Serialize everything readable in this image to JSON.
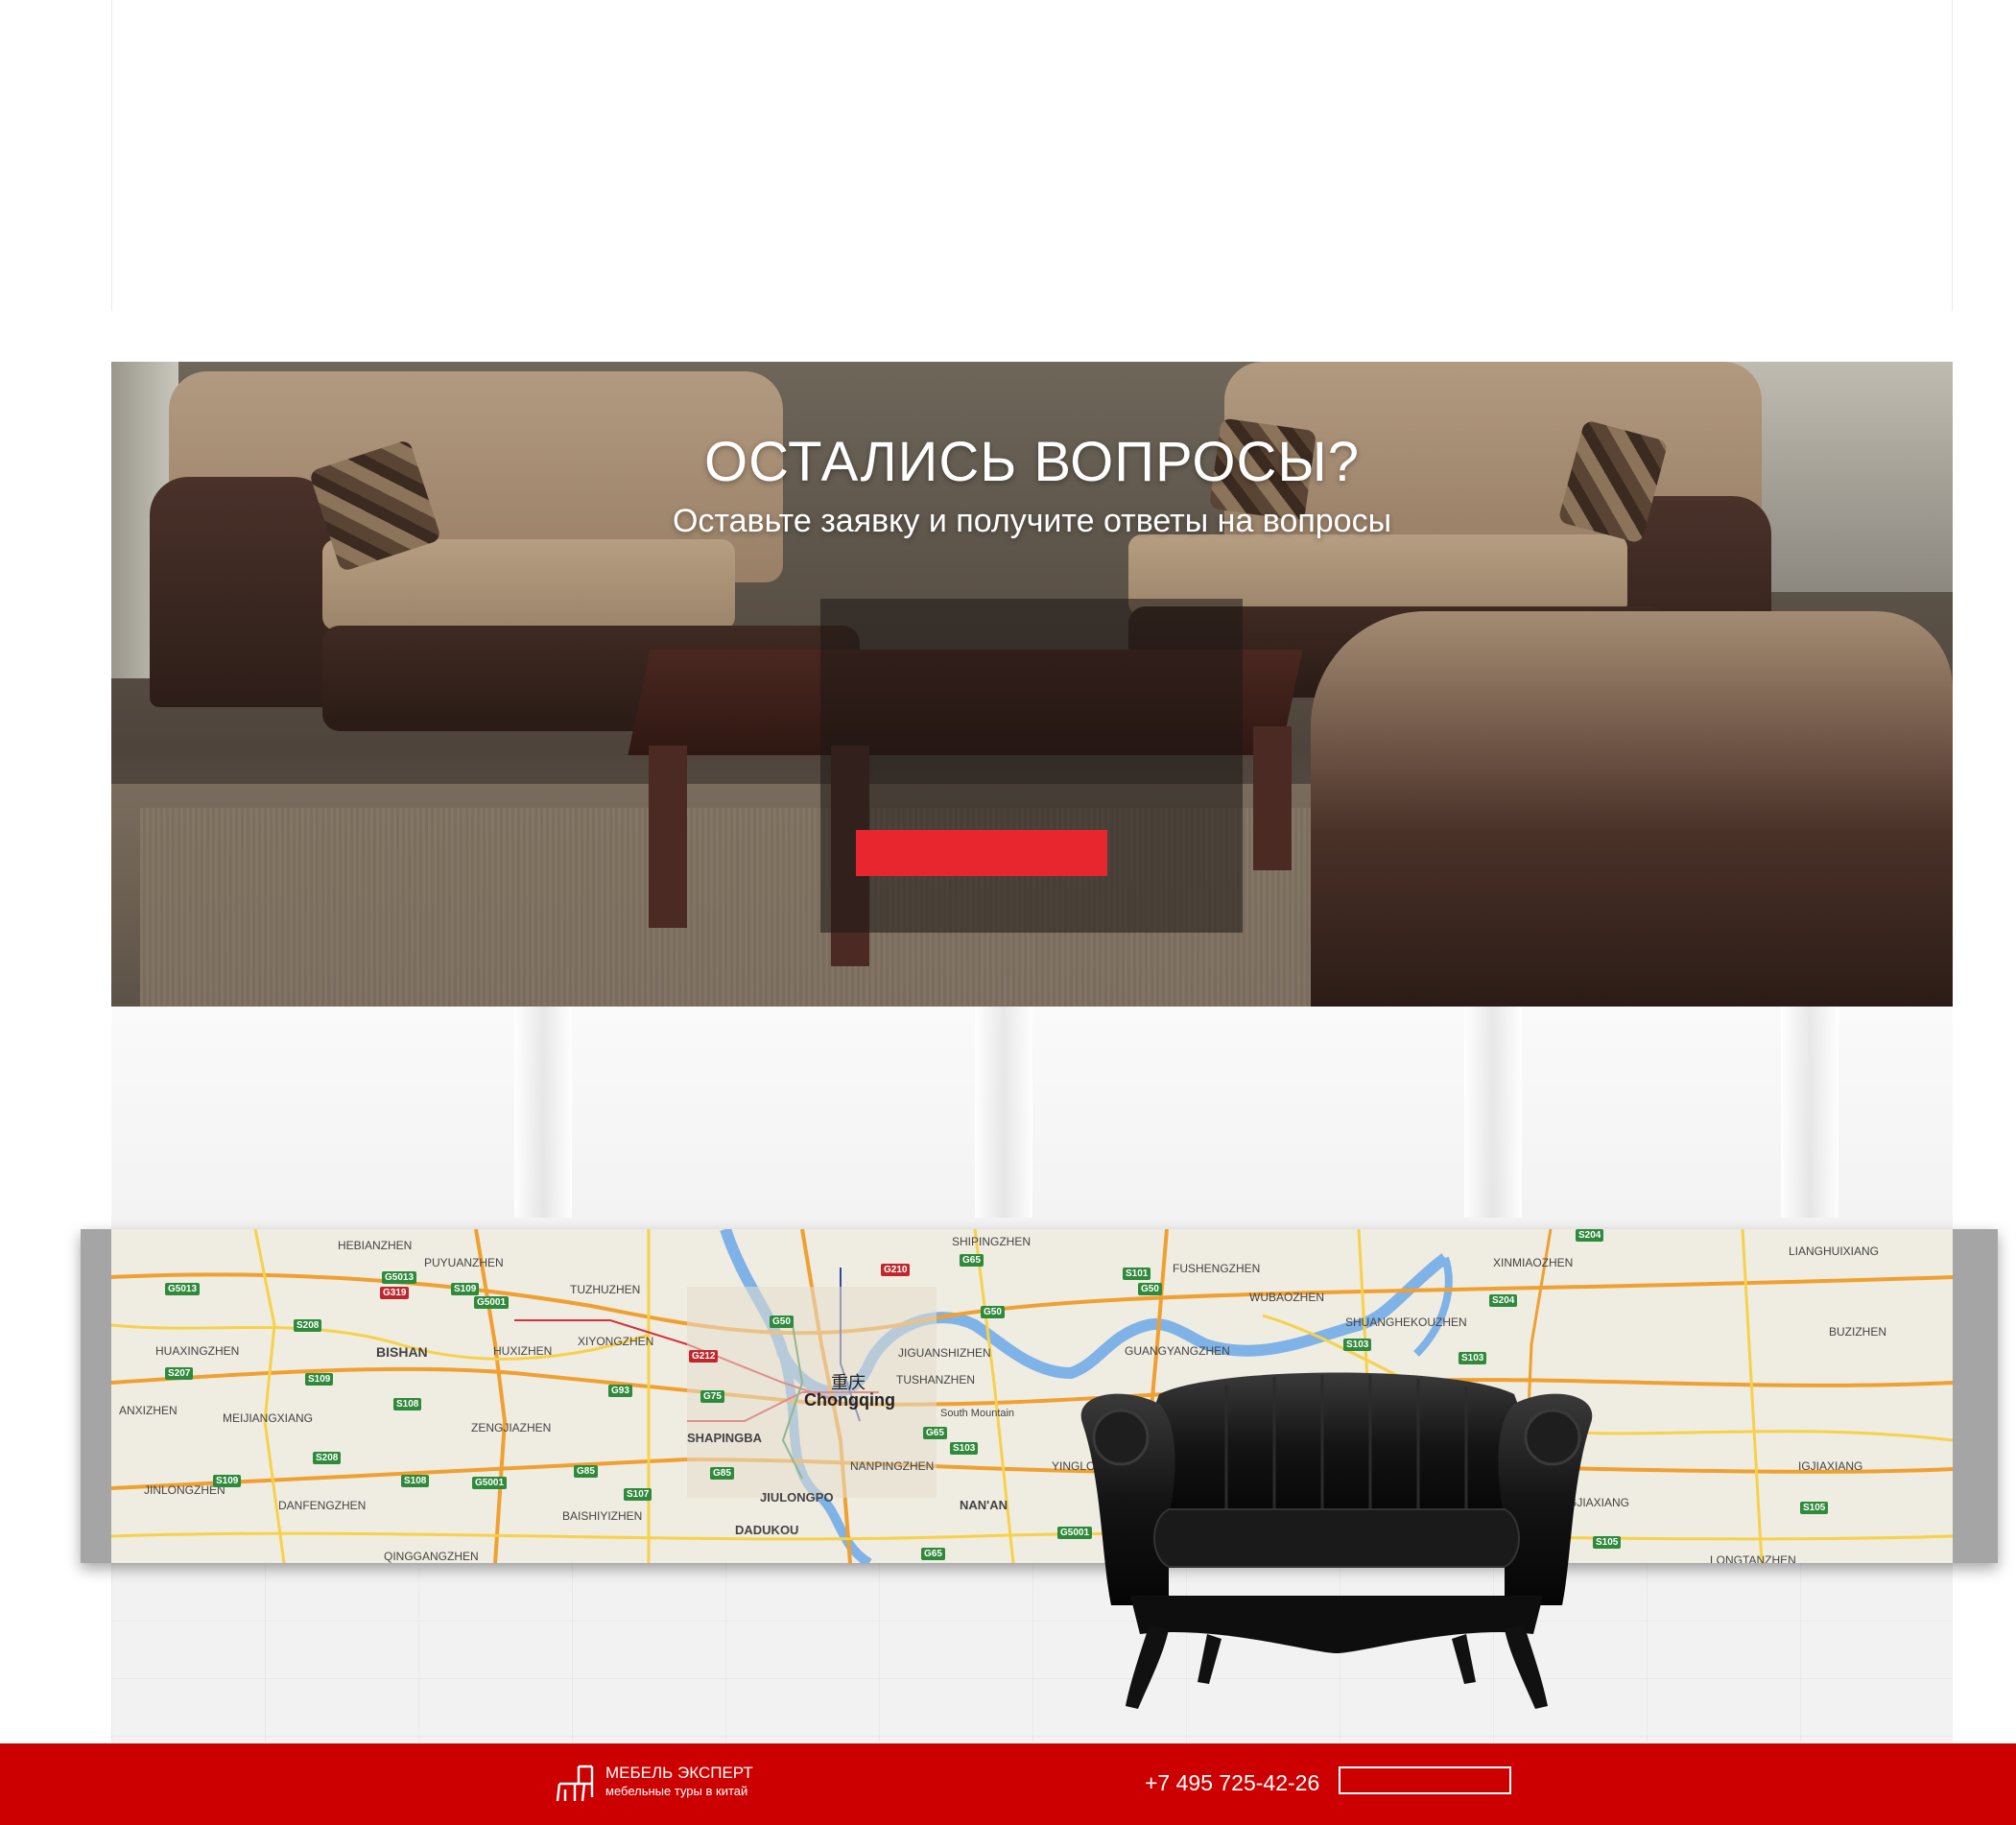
{
  "questions": {
    "title": "ОСТАЛИСЬ ВОПРОСЫ?",
    "subtitle": "Оставьте заявку и получите ответы на вопросы",
    "submit_label": ""
  },
  "map": {
    "city_cn": "重庆",
    "city": "Chongqing",
    "labels": [
      "HEBIANZHEN",
      "PUYUANZHEN",
      "TUZHUZHEN",
      "XIYONGZHEN",
      "HUAXINGZHEN",
      "BISHAN",
      "HUXIZHEN",
      "ANXIZHEN",
      "MEIJIANGXIANG",
      "ZENGJIAZHEN",
      "SHAPINGBA",
      "JINLONGZHEN",
      "DANFENGZHEN",
      "BAISHIYIZHEN",
      "JIULONGPO",
      "DADUKOU",
      "QINGGANGZHEN",
      "JIGUANSHIZHEN",
      "TUSHANZHEN",
      "NANPINGZHEN",
      "NAN'AN",
      "YINGLONGZHEN",
      "GUANGYANGZHEN",
      "WUBAOZHEN",
      "FUSHENGZHEN",
      "SHUANGHEKOUZHEN",
      "XINMIAOZHEN",
      "LIANGHUIXIANG",
      "BUZIZHEN",
      "IGJIAXIANG",
      "MINGJIAXIANG",
      "LONGTANZHEN",
      "SHIPINGZHEN",
      "South Mountain"
    ],
    "shields": [
      "G5013",
      "G5013",
      "G319",
      "S109",
      "G5001",
      "S208",
      "S207",
      "S109",
      "S108",
      "S208",
      "S109",
      "S108",
      "G5001",
      "G85",
      "S107",
      "G85",
      "G93",
      "G75",
      "G212",
      "G50",
      "G210",
      "G65",
      "G50",
      "S101",
      "G50",
      "G65",
      "S103",
      "S103",
      "S204",
      "S204",
      "S103",
      "S105",
      "S105",
      "G5001",
      "G65"
    ]
  },
  "footer": {
    "brand_name": "МЕБЕЛЬ ЭКСПЕРТ",
    "brand_tagline": "мебельные туры в китай",
    "phone": "+7 495 725-42-26",
    "callback_label": ""
  },
  "colors": {
    "accent_red": "#e8262e",
    "footer_red": "#cc0000"
  }
}
